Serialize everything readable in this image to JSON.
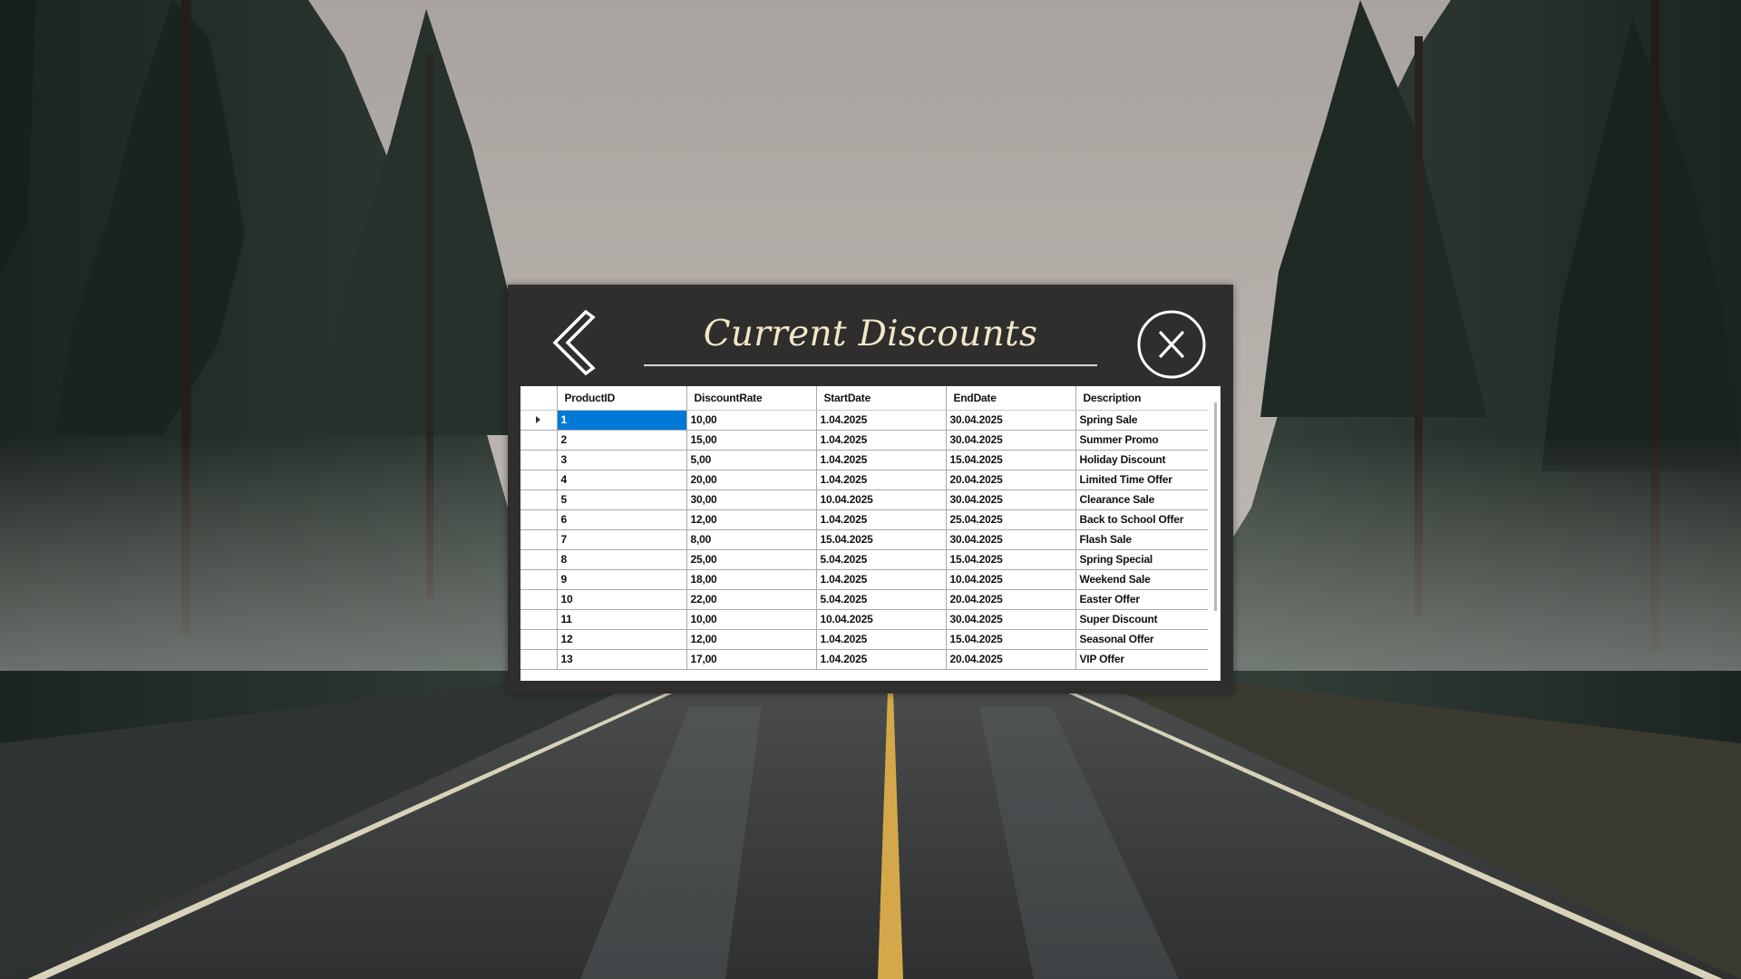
{
  "window": {
    "title": "Current Discounts"
  },
  "icons": {
    "back": "chevron-left-icon",
    "close": "close-icon"
  },
  "colors": {
    "dialog_bg": "#2f2e2d",
    "title_text": "#f2e7c9",
    "selection": "#0078d7"
  },
  "grid": {
    "columns": [
      "ProductID",
      "DiscountRate",
      "StartDate",
      "EndDate",
      "Description"
    ],
    "selected_row": 0,
    "selected_column": 0,
    "rows": [
      [
        "1",
        "10,00",
        "1.04.2025",
        "30.04.2025",
        "Spring Sale"
      ],
      [
        "2",
        "15,00",
        "1.04.2025",
        "30.04.2025",
        "Summer Promo"
      ],
      [
        "3",
        "5,00",
        "1.04.2025",
        "15.04.2025",
        "Holiday Discount"
      ],
      [
        "4",
        "20,00",
        "1.04.2025",
        "20.04.2025",
        "Limited Time Offer"
      ],
      [
        "5",
        "30,00",
        "10.04.2025",
        "30.04.2025",
        "Clearance Sale"
      ],
      [
        "6",
        "12,00",
        "1.04.2025",
        "25.04.2025",
        "Back to School Offer"
      ],
      [
        "7",
        "8,00",
        "15.04.2025",
        "30.04.2025",
        "Flash Sale"
      ],
      [
        "8",
        "25,00",
        "5.04.2025",
        "15.04.2025",
        "Spring Special"
      ],
      [
        "9",
        "18,00",
        "1.04.2025",
        "10.04.2025",
        "Weekend Sale"
      ],
      [
        "10",
        "22,00",
        "5.04.2025",
        "20.04.2025",
        "Easter Offer"
      ],
      [
        "11",
        "10,00",
        "10.04.2025",
        "30.04.2025",
        "Super Discount"
      ],
      [
        "12",
        "12,00",
        "1.04.2025",
        "15.04.2025",
        "Seasonal Offer"
      ],
      [
        "13",
        "17,00",
        "1.04.2025",
        "20.04.2025",
        "VIP Offer"
      ]
    ]
  }
}
